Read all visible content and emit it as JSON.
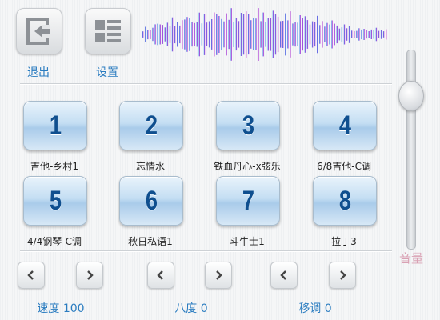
{
  "header": {
    "exit": {
      "label": "退出",
      "icon": "exit-icon"
    },
    "settings": {
      "label": "设置",
      "icon": "list-icon"
    },
    "waveform_colors": [
      "#2aa6e8",
      "#8a4fe0",
      "#e04fd0"
    ]
  },
  "pads": [
    {
      "number": "1",
      "label": "吉他-乡村1"
    },
    {
      "number": "2",
      "label": "忘情水"
    },
    {
      "number": "3",
      "label": "铁血丹心-x弦乐"
    },
    {
      "number": "4",
      "label": "6/8吉他-C调"
    },
    {
      "number": "5",
      "label": "4/4钢琴-C调"
    },
    {
      "number": "6",
      "label": "秋日私语1"
    },
    {
      "number": "7",
      "label": "斗牛士1"
    },
    {
      "number": "8",
      "label": "拉丁3"
    }
  ],
  "controls": {
    "speed": {
      "label": "速度 100"
    },
    "octave": {
      "label": "八度 0"
    },
    "transpose": {
      "label": "移调 0"
    }
  },
  "volume": {
    "label": "音量",
    "level": 0.82
  },
  "colors": {
    "accent": "#2a7cc0",
    "pad_number": "#0f4f8f",
    "volume_label": "#d9a1b4"
  }
}
